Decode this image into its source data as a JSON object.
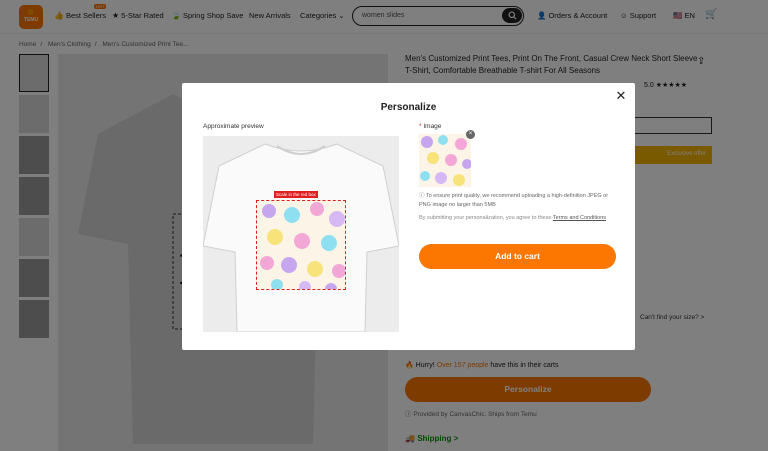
{
  "header": {
    "logo_text": "TEMU",
    "nav": [
      {
        "icon": "thumbs-up-icon",
        "label": "Best Sellers",
        "badge": "HOT"
      },
      {
        "icon": "star-icon",
        "label": "5-Star Rated"
      },
      {
        "icon": "leaf-icon",
        "label": "Spring Shop Save"
      },
      {
        "label": "New Arrivals"
      },
      {
        "label": "Categories"
      }
    ],
    "search_value": "women slides",
    "account_label": "Orders & Account",
    "support_label": "Support",
    "language": "EN"
  },
  "breadcrumb": [
    "Home",
    "Men's Clothing",
    "Men's Customized Print Tee..."
  ],
  "product": {
    "title": "Men's Customized Print Tees, Print On The Front, Casual Crew Neck Short Sleeve T-Shirt, Comfortable Breathable T-shirt For All Seasons",
    "rating_value": "5.0",
    "rating_stars": 5,
    "exclusive_label": "Exclusive offer",
    "cant_find_size": "Can't find your size? >",
    "hurry_prefix": "Hurry!",
    "hurry_count": "Over 157 people",
    "hurry_suffix": "have this in their carts",
    "personalize_label": "Personalize",
    "provided_by": "Provided by CanvasChic. Ships from Temu",
    "shipping_label": "Shipping >"
  },
  "modal": {
    "title": "Personalize",
    "preview_label": "Approximate preview",
    "scale_tag": "Scale in the red box",
    "image_label": "Image",
    "required_mark": "*",
    "quality_note": "To ensure print quality, we recommend uploading a high-definition JPEG or PNG image no larger than 5MB",
    "agree_prefix": "By submitting your personalization, you agree to these",
    "agree_link": "Terms and Conditions",
    "add_to_cart": "Add to cart"
  },
  "colors": {
    "accent": "#fb7701",
    "scale_red": "#e02020",
    "shipping_green": "#0a8f08"
  }
}
